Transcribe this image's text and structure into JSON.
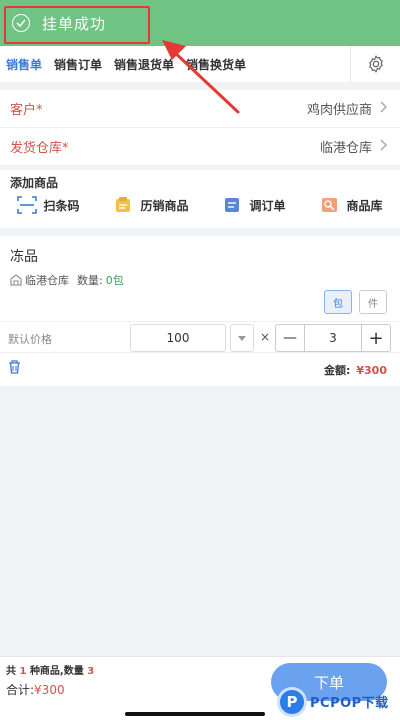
{
  "toast": {
    "text": "挂单成功"
  },
  "tabs": [
    {
      "label": "销售单"
    },
    {
      "label": "销售订单"
    },
    {
      "label": "销售退货单"
    },
    {
      "label": "销售换货单"
    }
  ],
  "form": {
    "customer": {
      "label": "客户*",
      "value": "鸡肉供应商"
    },
    "warehouse": {
      "label": "发货仓库*",
      "value": "临港仓库"
    }
  },
  "add_goods": {
    "title": "添加商品",
    "items": [
      {
        "label": "扫条码"
      },
      {
        "label": "历销商品"
      },
      {
        "label": "调订单"
      },
      {
        "label": "商品库"
      }
    ]
  },
  "product": {
    "name": "冻品",
    "warehouse": "临港仓库",
    "qty_label": "数量:",
    "qty_value": "0包",
    "unit_pack": "包",
    "unit_piece": "件",
    "price_label": "默认价格",
    "price": "100",
    "times": "×",
    "quantity": "3",
    "minus": "—",
    "plus": "+",
    "amount_label": "金额:",
    "amount_value": "¥300"
  },
  "footer": {
    "summary_prefix": "共",
    "kinds": "1",
    "summary_mid": "种商品,数量",
    "count": "3",
    "total_label": "合计:",
    "total_value": "¥300",
    "submit_label": "下单"
  },
  "watermark": {
    "logo": "P",
    "text": "PCPOP下载"
  },
  "colors": {
    "toast_bg": "#6fc383",
    "accent": "#3a7bd5",
    "required_label": "#d0534a",
    "submit_bg": "#6aa2ef",
    "annotation": "#e53935"
  }
}
